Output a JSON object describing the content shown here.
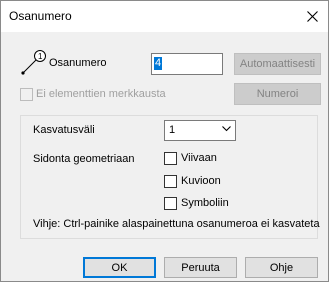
{
  "window": {
    "title": "Osanumero"
  },
  "icons": {
    "close": "close-icon",
    "part_number": "part-number-icon",
    "chevron": "chevron-down-icon"
  },
  "part_number": {
    "label": "Osanumero",
    "value": "4",
    "auto_button": "Automaattisesti",
    "auto_button_enabled": false
  },
  "no_element_marking": {
    "label": "Ei elementtien merkkausta",
    "checked": false,
    "enabled": false
  },
  "number_button": {
    "label": "Numeroi",
    "enabled": false
  },
  "increment": {
    "label": "Kasvatusväli",
    "selected": "1"
  },
  "binding": {
    "label": "Sidonta geometriaan",
    "options": [
      {
        "label": "Viivaan",
        "checked": false
      },
      {
        "label": "Kuvioon",
        "checked": false
      },
      {
        "label": "Symboliin",
        "checked": false
      }
    ]
  },
  "hint": "Vihje: Ctrl-painike alaspainettuna osanumeroa ei kasvateta",
  "footer": {
    "ok": "OK",
    "cancel": "Peruuta",
    "help": "Ohje"
  },
  "colors": {
    "accent": "#0078d7",
    "dialog_bg": "#f0f0f0",
    "disabled_text": "#a0a0a0"
  }
}
